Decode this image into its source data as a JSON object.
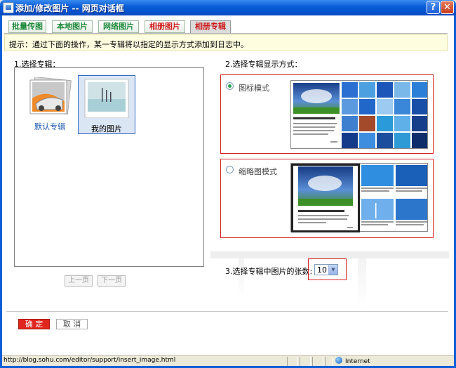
{
  "window": {
    "title": "添加/修改图片 -- 网页对话框",
    "help_label": "?",
    "close_label": "✕"
  },
  "tabs": [
    {
      "label": "批量传图",
      "color": "green"
    },
    {
      "label": "本地图片",
      "color": "green"
    },
    {
      "label": "网络图片",
      "color": "green"
    },
    {
      "label": "相册图片",
      "color": "red"
    },
    {
      "label": "相册专辑",
      "color": "red",
      "active": true
    }
  ],
  "hint": "提示：通过下面的操作，某一专辑将以指定的显示方式添加到日志中。",
  "step1": {
    "label": "1.选择专辑：",
    "albums": [
      {
        "label": "默认专辑",
        "icon": "photo-stack-icon",
        "selected": false
      },
      {
        "label": "我的图片",
        "icon": "seascape-photo-icon",
        "selected": true
      }
    ],
    "prev_label": "上一页",
    "next_label": "下一页"
  },
  "step2": {
    "label": "2.选择专辑显示方式：",
    "modes": [
      {
        "label": "图标模式",
        "selected": true,
        "preview_caption": "欣赏专集的美景，让人美不胜收",
        "preview_body": "我来了，这里是…为每次重大事件比如小说，这也是过去遇到过的最好的，其实我一直都是这样的…",
        "preview_more": "纪念"
      },
      {
        "label": "缩略图模式",
        "selected": false,
        "preview_caption": "优雅的美丽，让人美不胜收",
        "preview_body": "我来了，这里是……为每次大事都比如小说，这也是……",
        "preview_more": "纪念",
        "thumb_captions": [
          "大海在那一片蓝，一年四季都那么美",
          "天空下的那一座也是很美丽的",
          "白云和风车一起呈现在眼前",
          "蓝色的大海，一半是天空"
        ]
      }
    ]
  },
  "step3": {
    "label": "3.选择专辑中图片的张数:",
    "value": "10"
  },
  "actions": {
    "ok_label": "确 定",
    "cancel_label": "取 消"
  },
  "status": {
    "url": "http://blog.sohu.com/editor/support/insert_image.html",
    "zone": "Internet"
  },
  "colors": {
    "titlebar": "#0a5fd8",
    "highlight": "#d42020",
    "ok_button": "#e0261e"
  }
}
